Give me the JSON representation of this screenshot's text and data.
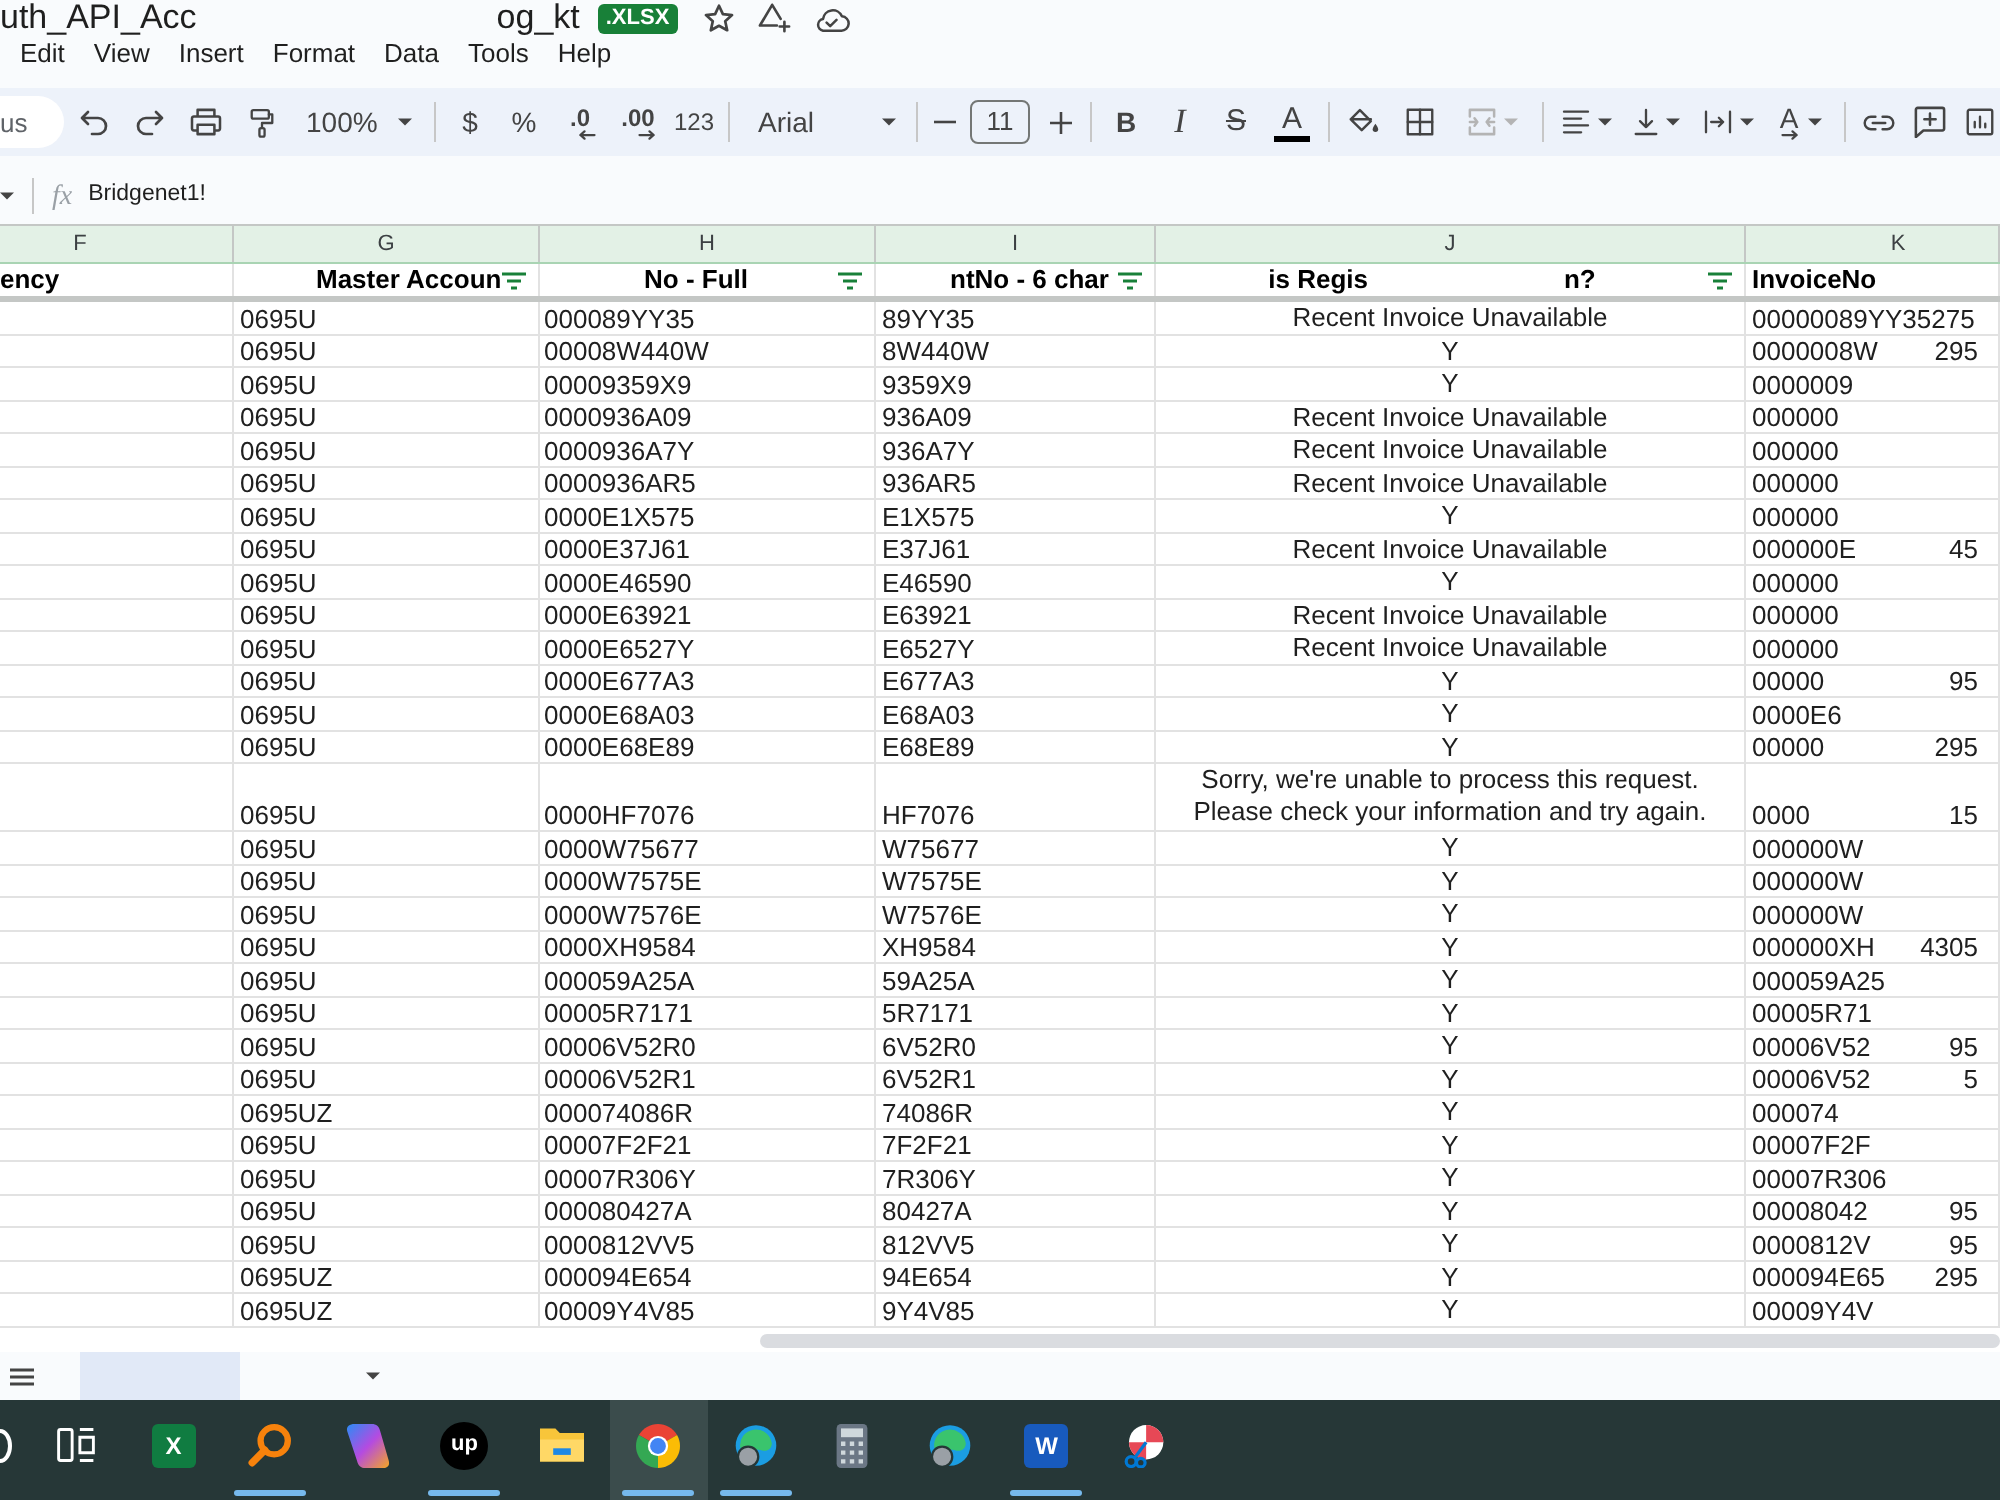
{
  "document": {
    "title_start": "uth_API_Acc",
    "title_end": "og_kt",
    "badge": ".XLSX"
  },
  "menu": [
    "Edit",
    "View",
    "Insert",
    "Format",
    "Data",
    "Tools",
    "Help"
  ],
  "search": {
    "placeholder": "us"
  },
  "toolbar_groups": [
    [
      {
        "kind": "undo",
        "disabled": false
      },
      {
        "kind": "redo",
        "disabled": false
      },
      {
        "kind": "print",
        "disabled": false
      },
      {
        "kind": "paint_format",
        "disabled": false
      },
      {
        "kind": "zoom",
        "label": "100%",
        "disabled": false
      }
    ],
    [
      {
        "kind": "currency",
        "label": "$",
        "disabled": false
      },
      {
        "kind": "percent",
        "label": "%",
        "disabled": false
      },
      {
        "kind": "decimal_decrease",
        "label": ".0",
        "disabled": false
      },
      {
        "kind": "decimal_increase",
        "label": ".00",
        "disabled": false
      },
      {
        "kind": "number_format",
        "label": "123",
        "disabled": false
      }
    ],
    [
      {
        "kind": "font",
        "label": "Arial",
        "disabled": false
      }
    ],
    [
      {
        "kind": "font_size_decrease",
        "disabled": false
      },
      {
        "kind": "font_size",
        "label": "11",
        "disabled": false
      },
      {
        "kind": "font_size_increase",
        "disabled": false
      }
    ],
    [
      {
        "kind": "bold",
        "label": "B",
        "disabled": false
      },
      {
        "kind": "italic",
        "label": "I",
        "disabled": false
      },
      {
        "kind": "strikethrough",
        "label": "S",
        "disabled": false
      },
      {
        "kind": "text_color",
        "label": "A",
        "disabled": false
      }
    ],
    [
      {
        "kind": "fill_color",
        "disabled": false
      },
      {
        "kind": "borders",
        "disabled": false
      },
      {
        "kind": "merge",
        "disabled": true
      }
    ],
    [
      {
        "kind": "align",
        "disabled": false
      },
      {
        "kind": "valign",
        "disabled": false
      },
      {
        "kind": "wrap",
        "disabled": false
      },
      {
        "kind": "rotate",
        "label": "A",
        "disabled": false
      }
    ],
    [
      {
        "kind": "link",
        "disabled": false
      },
      {
        "kind": "comment",
        "disabled": false
      },
      {
        "kind": "chart",
        "disabled": false
      }
    ]
  ],
  "formula_bar": {
    "fx": "fx",
    "value": "Bridgenet1!"
  },
  "columns": [
    {
      "letter": "F",
      "header": "ency",
      "filter": false
    },
    {
      "letter": "G",
      "header": "Master Accoun",
      "filter": true
    },
    {
      "letter": "H",
      "header": "No - Full",
      "filter": true
    },
    {
      "letter": "I",
      "header": "ntNo - 6 char",
      "filter": true
    },
    {
      "letter": "J",
      "header": "is Regis",
      "header_tail": "n?",
      "filter": true
    },
    {
      "letter": "K",
      "header": "InvoiceNo",
      "filter": false
    }
  ],
  "rows": [
    {
      "g": "0695U",
      "h": "000089YY35",
      "i": "89YY35",
      "j": [
        "Recent Invoice Unavailable"
      ],
      "k": "00000089YY35275"
    },
    {
      "g": "0695U",
      "h": "00008W440W",
      "i": "8W440W",
      "j": [
        "Y"
      ],
      "k": "0000008W",
      "k_tail": "295"
    },
    {
      "g": "0695U",
      "h": "00009359X9",
      "i": "9359X9",
      "j": [
        "Y"
      ],
      "k": "0000009"
    },
    {
      "g": "0695U",
      "h": "0000936A09",
      "i": "936A09",
      "j": [
        "Recent Invoice Unavailable"
      ],
      "k": "000000"
    },
    {
      "g": "0695U",
      "h": "0000936A7Y",
      "i": "936A7Y",
      "j": [
        "Recent Invoice Unavailable"
      ],
      "k": "000000"
    },
    {
      "g": "0695U",
      "h": "0000936AR5",
      "i": "936AR5",
      "j": [
        "Recent Invoice Unavailable"
      ],
      "k": "000000"
    },
    {
      "g": "0695U",
      "h": "0000E1X575",
      "i": "E1X575",
      "j": [
        "Y"
      ],
      "k": "000000"
    },
    {
      "g": "0695U",
      "h": "0000E37J61",
      "i": "E37J61",
      "j": [
        "Recent Invoice Unavailable"
      ],
      "k": "000000E",
      "k_tail": "45"
    },
    {
      "g": "0695U",
      "h": "0000E46590",
      "i": "E46590",
      "j": [
        "Y"
      ],
      "k": "000000"
    },
    {
      "g": "0695U",
      "h": "0000E63921",
      "i": "E63921",
      "j": [
        "Recent Invoice Unavailable"
      ],
      "k": "000000"
    },
    {
      "g": "0695U",
      "h": "0000E6527Y",
      "i": "E6527Y",
      "j": [
        "Recent Invoice Unavailable"
      ],
      "k": "000000"
    },
    {
      "g": "0695U",
      "h": "0000E677A3",
      "i": "E677A3",
      "j": [
        "Y"
      ],
      "k": "00000",
      "k_tail": "95"
    },
    {
      "g": "0695U",
      "h": "0000E68A03",
      "i": "E68A03",
      "j": [
        "Y"
      ],
      "k": "0000E6"
    },
    {
      "g": "0695U",
      "h": "0000E68E89",
      "i": "E68E89",
      "j": [
        "Y"
      ],
      "k": "00000",
      "k_tail": "295"
    },
    {
      "g": "0695U",
      "h": "0000HF7076",
      "i": "HF7076",
      "j": [
        "Sorry, we're unable to process this request.",
        "Please check your information and try again."
      ],
      "k": "0000",
      "k_tail": "15"
    },
    {
      "g": "0695U",
      "h": "0000W75677",
      "i": "W75677",
      "j": [
        "Y"
      ],
      "k": "000000W"
    },
    {
      "g": "0695U",
      "h": "0000W7575E",
      "i": "W7575E",
      "j": [
        "Y"
      ],
      "k": "000000W"
    },
    {
      "g": "0695U",
      "h": "0000W7576E",
      "i": "W7576E",
      "j": [
        "Y"
      ],
      "k": "000000W"
    },
    {
      "g": "0695U",
      "h": "0000XH9584",
      "i": "XH9584",
      "j": [
        "Y"
      ],
      "k": "000000XH",
      "k_tail": "4305"
    },
    {
      "g": "0695U",
      "h": "000059A25A",
      "i": "59A25A",
      "j": [
        "Y"
      ],
      "k": "000059A25"
    },
    {
      "g": "0695U",
      "h": "00005R7171",
      "i": "5R7171",
      "j": [
        "Y"
      ],
      "k": "00005R71"
    },
    {
      "g": "0695U",
      "h": "00006V52R0",
      "i": "6V52R0",
      "j": [
        "Y"
      ],
      "k": "00006V52",
      "k_tail": "95"
    },
    {
      "g": "0695U",
      "h": "00006V52R1",
      "i": "6V52R1",
      "j": [
        "Y"
      ],
      "k": "00006V52",
      "k_tail": "5"
    },
    {
      "g": "0695UZ",
      "h": "000074086R",
      "i": "74086R",
      "j": [
        "Y"
      ],
      "k": "000074"
    },
    {
      "g": "0695U",
      "h": "00007F2F21",
      "i": "7F2F21",
      "j": [
        "Y"
      ],
      "k": "00007F2F"
    },
    {
      "g": "0695U",
      "h": "00007R306Y",
      "i": "7R306Y",
      "j": [
        "Y"
      ],
      "k": "00007R306"
    },
    {
      "g": "0695U",
      "h": "000080427A",
      "i": "80427A",
      "j": [
        "Y"
      ],
      "k": "00008042",
      "k_tail": "95"
    },
    {
      "g": "0695U",
      "h": "0000812VV5",
      "i": "812VV5",
      "j": [
        "Y"
      ],
      "k": "0000812V",
      "k_tail": "95"
    },
    {
      "g": "0695UZ",
      "h": "000094E654",
      "i": "94E654",
      "j": [
        "Y"
      ],
      "k": "000094E65",
      "k_tail": "295"
    },
    {
      "g": "0695UZ",
      "h": "00009Y4V85",
      "i": "9Y4V85",
      "j": [
        "Y"
      ],
      "k": "00009Y4V"
    }
  ],
  "sheet_tabs": [
    {
      "selected": true
    }
  ],
  "taskbar": [
    {
      "kind": "ring",
      "running": false,
      "active": false
    },
    {
      "kind": "task_view",
      "running": false,
      "active": false
    },
    {
      "kind": "excel",
      "label": "X",
      "running": false,
      "active": false
    },
    {
      "kind": "magnifier",
      "running": true,
      "active": false
    },
    {
      "kind": "copilot",
      "running": false,
      "active": false
    },
    {
      "kind": "upwork",
      "label": "up",
      "running": true,
      "active": false
    },
    {
      "kind": "explorer",
      "running": false,
      "active": false
    },
    {
      "kind": "chrome",
      "running": true,
      "active": true
    },
    {
      "kind": "edge_profile",
      "running": true,
      "active": false
    },
    {
      "kind": "calculator",
      "running": false,
      "active": false
    },
    {
      "kind": "edge_profile",
      "running": false,
      "active": false
    },
    {
      "kind": "word",
      "label": "W",
      "running": true,
      "active": false
    },
    {
      "kind": "snipping",
      "running": false,
      "active": false
    }
  ]
}
